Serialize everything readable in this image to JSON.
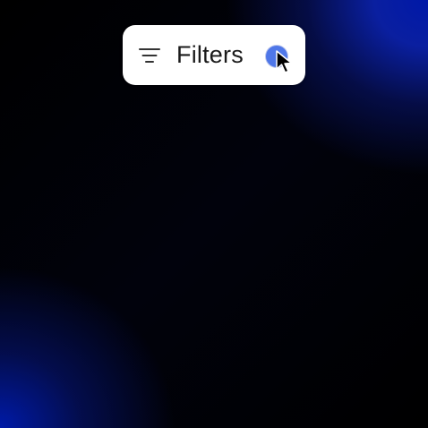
{
  "filters_button": {
    "label": "Filters",
    "icon": "filter-lines-icon"
  },
  "cursor": {
    "icon": "arrow-pointer-icon"
  },
  "colors": {
    "button_bg": "#ffffff",
    "badge": "#4f77e8",
    "label_text": "#1a1a1a",
    "background_accent": "#0018a8"
  }
}
